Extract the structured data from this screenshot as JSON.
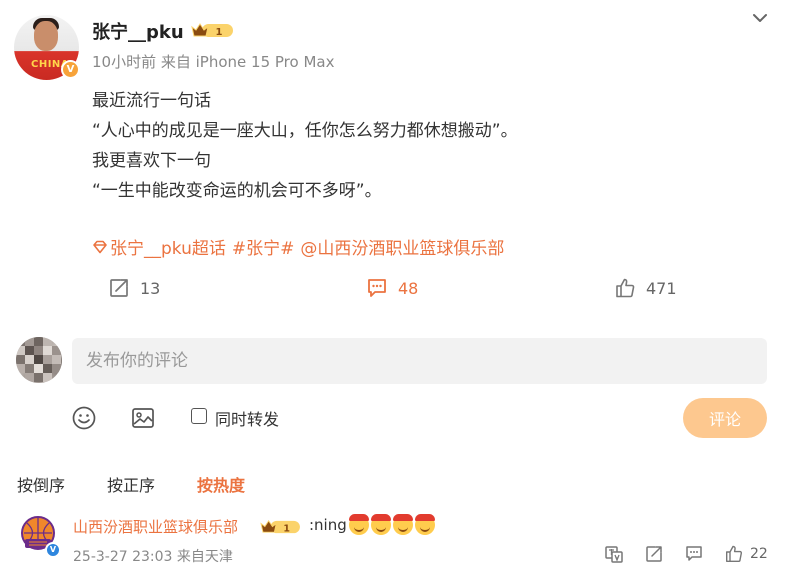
{
  "post": {
    "author": "张宁__pku",
    "avatar_jersey_text": "CHINA",
    "verified_mark": "V",
    "vip_level": "1",
    "meta": "10小时前 来自 iPhone 15 Pro Max",
    "lines": [
      "最近流行一句话",
      "“人心中的成见是一座大山，任你怎么努力都休想搬动”。",
      "我更喜欢下一句",
      "“一生中能改变命运的机会可不多呀”。"
    ],
    "tags": {
      "supertopic": "张宁__pku超话",
      "hashtag": "#张宁#",
      "mention": "@山西汾酒职业篮球俱乐部"
    },
    "actions": {
      "reposts": "13",
      "comments": "48",
      "likes": "471"
    }
  },
  "composer": {
    "placeholder": "发布你的评论",
    "repost_label": "同时转发",
    "submit_label": "评论"
  },
  "sort": {
    "tabs": [
      "按倒序",
      "按正序",
      "按热度"
    ],
    "active": "按热度"
  },
  "comments": [
    {
      "author": "山西汾酒职业篮球俱乐部",
      "vip_level": "1",
      "text": ":ning",
      "emoji_count": 4,
      "meta": "25-3-27 23:03 来自天津",
      "likes": "22"
    }
  ],
  "colors": {
    "accent": "#eb7340",
    "submit_disabled": "#fdc88f",
    "input_bg": "#f2f2f2",
    "verified_orange": "#f7a33a",
    "verified_blue": "#2e86de"
  }
}
